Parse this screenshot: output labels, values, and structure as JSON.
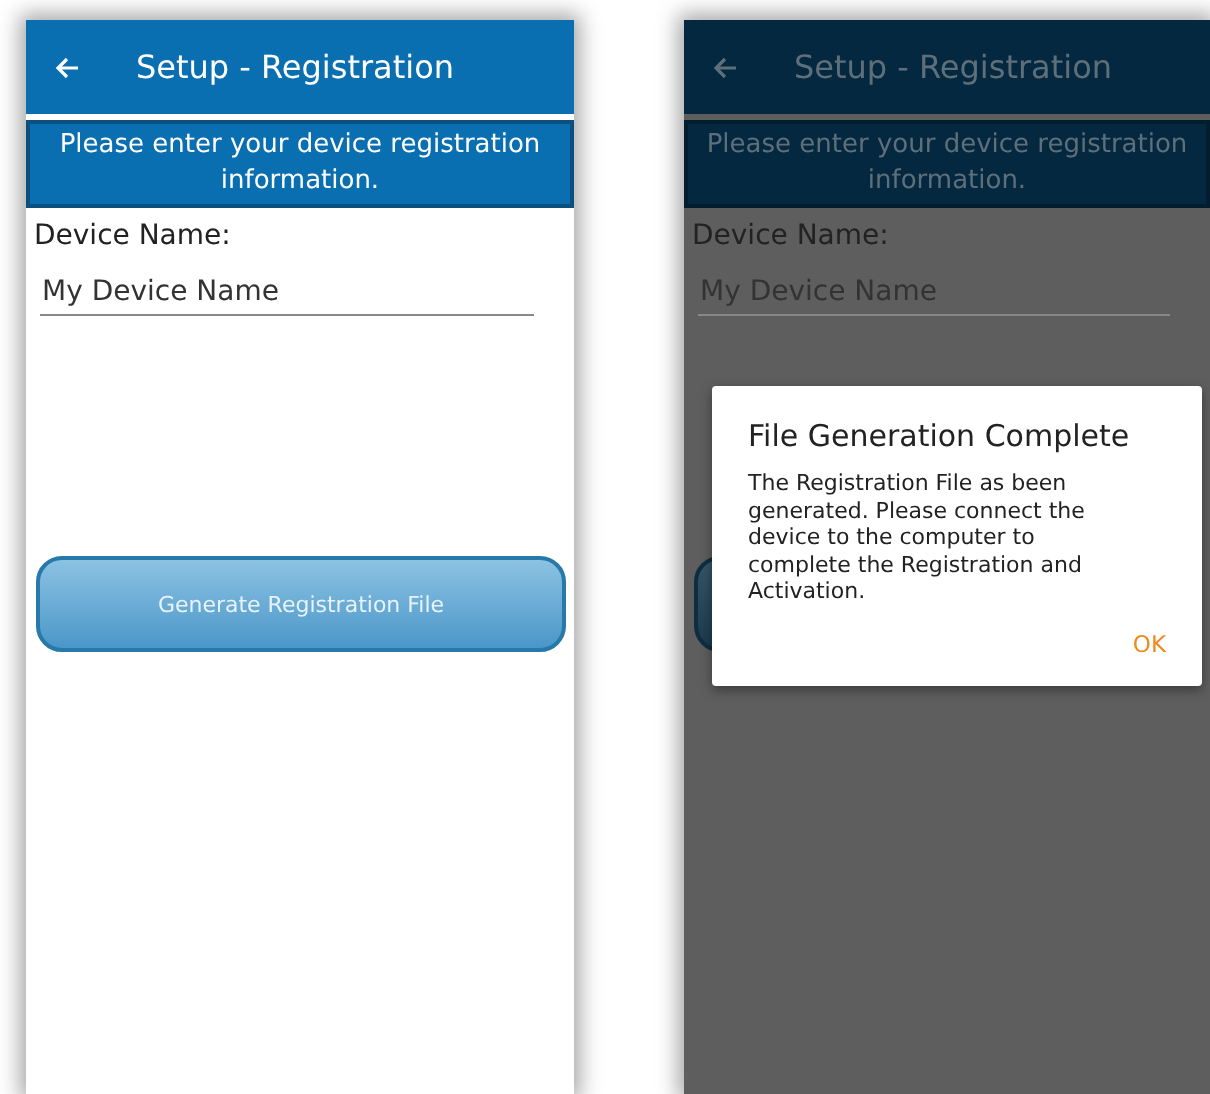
{
  "screens": [
    {
      "title": "Setup - Registration",
      "banner": "Please enter your device registration information.",
      "field_label": "Device Name:",
      "field_value": "My Device Name",
      "button": {
        "label": "Generate Registration File"
      },
      "dimmed": false
    },
    {
      "title": "Setup - Registration",
      "banner": "Please enter your device registration information.",
      "field_label": "Device Name:",
      "field_value": "My Device Name",
      "dimmed": true,
      "dialog": {
        "title": "File Generation Complete",
        "message": "The Registration File as been generated. Please connect the device to the computer to complete the Registration and Activation.",
        "action": "OK"
      }
    }
  ]
}
